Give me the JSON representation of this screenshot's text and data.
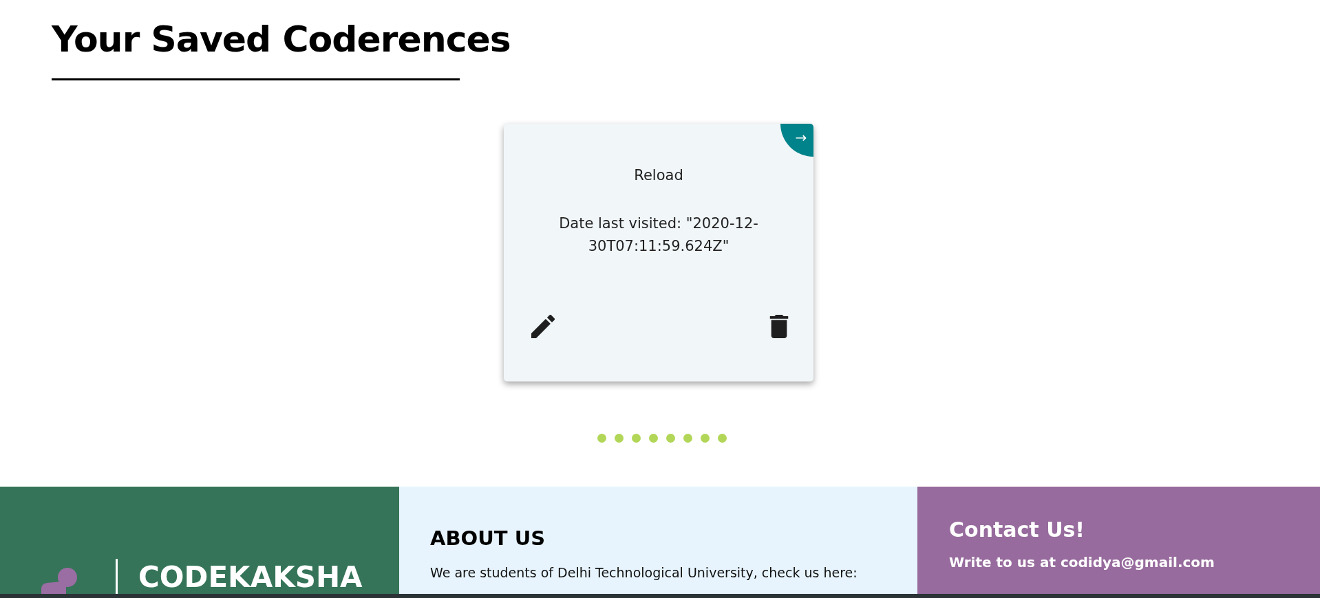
{
  "heading": "Your Saved Coderences",
  "card": {
    "title": "Reload",
    "date_text": "Date last visited: \"2020-12-30T07:11:59.624Z\"",
    "corner_symbol": "→"
  },
  "pagination": [
    {
      "kind": "dot"
    },
    {
      "kind": "dot"
    },
    {
      "kind": "dot"
    },
    {
      "kind": "dot"
    },
    {
      "kind": "dot"
    },
    {
      "kind": "dot"
    },
    {
      "kind": "dot"
    },
    {
      "kind": "dot"
    }
  ],
  "footer": {
    "brand": "CODEKAKSHA",
    "about_title": "ABOUT US",
    "about_text": "We are students of Delhi Technological University, check us here:",
    "contact_title": "Contact Us!",
    "contact_text": "Write to us at codidya@gmail.com"
  }
}
